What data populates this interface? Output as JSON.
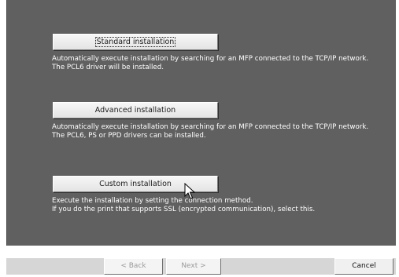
{
  "options": [
    {
      "button_label": "Standard installation",
      "description_lines": [
        "Automatically execute installation by searching for an MFP connected to the TCP/IP network.",
        "The PCL6 driver will be installed."
      ]
    },
    {
      "button_label": "Advanced installation",
      "description_lines": [
        "Automatically execute installation by searching for an MFP connected to the TCP/IP network.",
        "The PCL6, PS or PPD drivers can be installed."
      ]
    },
    {
      "button_label": "Custom installation",
      "description_lines": [
        "Execute the installation by setting the connection method.",
        "If you do the print that supports SSL (encrypted communication), select this."
      ]
    }
  ],
  "nav": {
    "back_label": "< Back",
    "next_label": "Next >",
    "cancel_label": "Cancel"
  },
  "colors": {
    "panel": "#606060",
    "button_face": "#e8e8e8",
    "text_on_panel": "#ffffff"
  }
}
